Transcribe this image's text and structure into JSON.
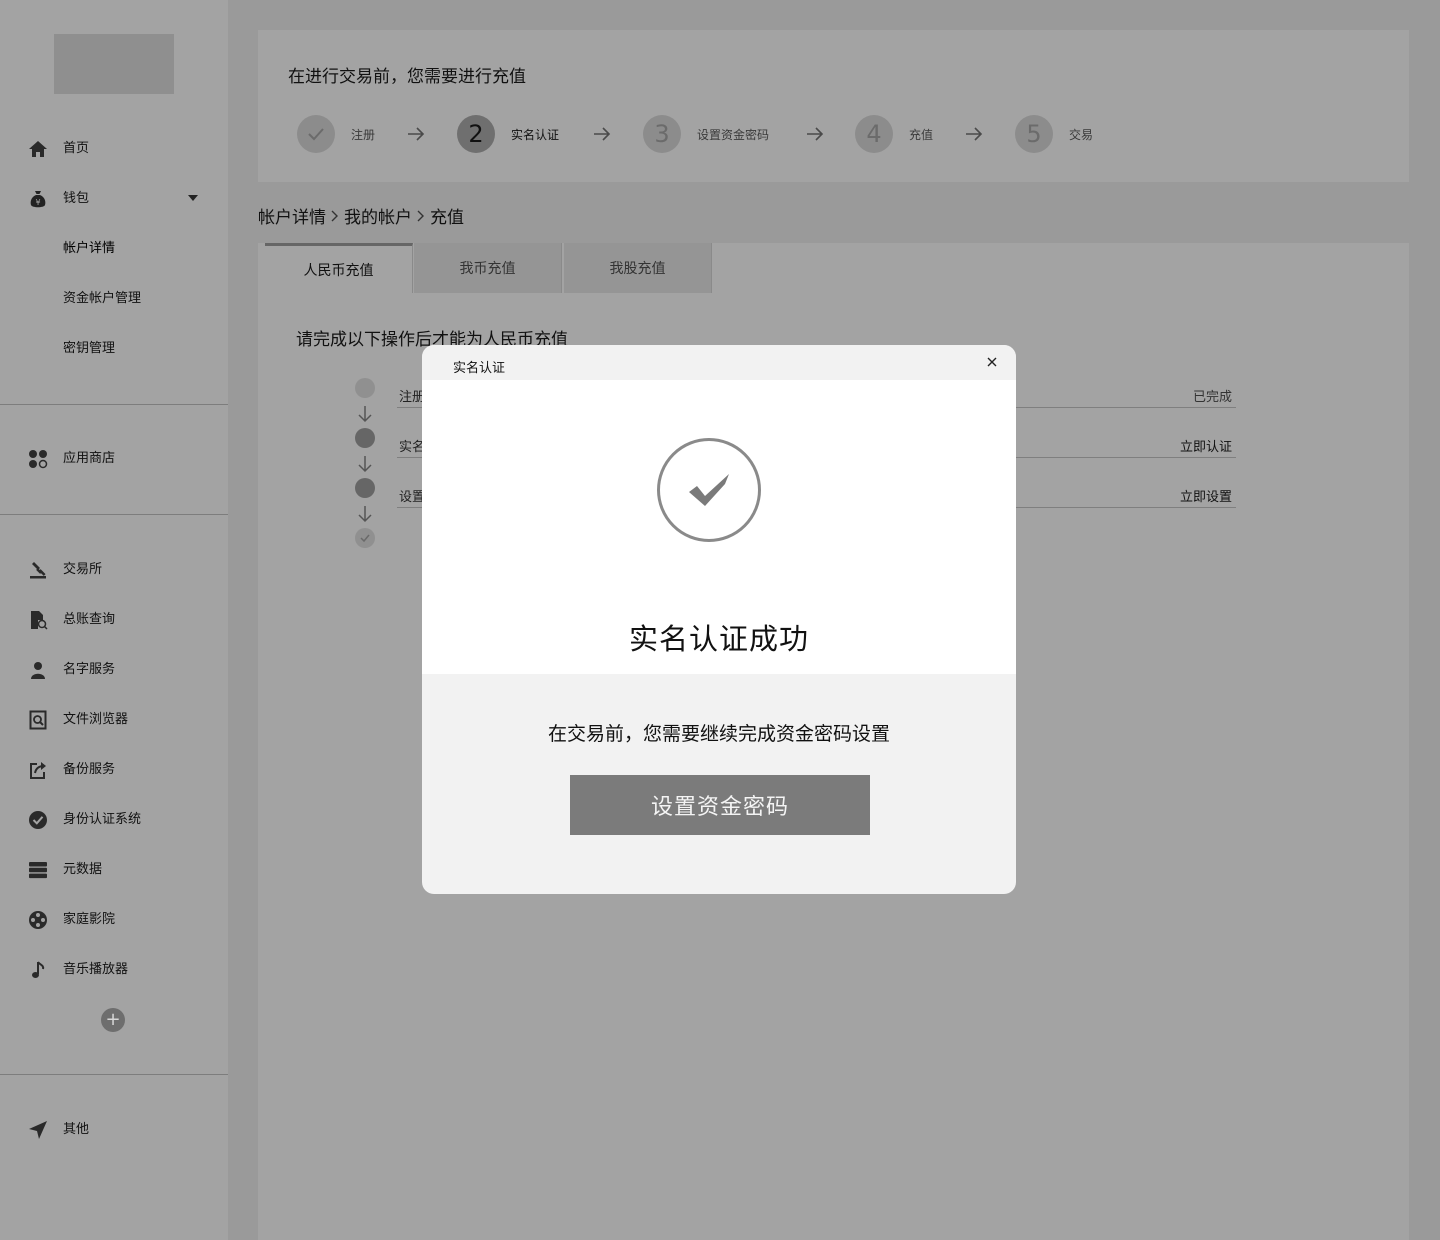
{
  "sidebar": {
    "items": [
      {
        "label": "首页",
        "icon": "home-icon"
      },
      {
        "label": "钱包",
        "icon": "money-bag-icon"
      },
      {
        "label": "帐户详情"
      },
      {
        "label": "资金帐户管理"
      },
      {
        "label": "密钥管理"
      },
      {
        "label": "应用商店",
        "icon": "apps-icon"
      },
      {
        "label": "交易所",
        "icon": "gavel-icon"
      },
      {
        "label": "总账查询",
        "icon": "ledger-search-icon"
      },
      {
        "label": "名字服务",
        "icon": "person-icon"
      },
      {
        "label": "文件浏览器",
        "icon": "file-search-icon"
      },
      {
        "label": "备份服务",
        "icon": "share-icon"
      },
      {
        "label": "身份认证系统",
        "icon": "verified-icon"
      },
      {
        "label": "元数据",
        "icon": "database-icon"
      },
      {
        "label": "家庭影院",
        "icon": "film-reel-icon"
      },
      {
        "label": "音乐播放器",
        "icon": "music-note-icon"
      },
      {
        "label": "其他",
        "icon": "navigation-arrow-icon"
      }
    ],
    "add_label": "+"
  },
  "steps": {
    "title": "在进行交易前，您需要进行充值",
    "items": [
      {
        "num": "✓",
        "label": "注册"
      },
      {
        "num": "2",
        "label": "实名认证"
      },
      {
        "num": "3",
        "label": "设置资金密码"
      },
      {
        "num": "4",
        "label": "充值"
      },
      {
        "num": "5",
        "label": "交易"
      }
    ]
  },
  "breadcrumb": [
    "帐户详情",
    "我的帐户",
    "充值"
  ],
  "tabs": [
    "人民币充值",
    "我币充值",
    "我股充值"
  ],
  "requirements": {
    "title": "请完成以下操作后才能为人民币充值",
    "rows": [
      {
        "label": "注册",
        "action": "已完成"
      },
      {
        "label": "实名",
        "action": "立即认证"
      },
      {
        "label": "设置",
        "action": "立即设置"
      }
    ]
  },
  "modal": {
    "title": "实名认证",
    "close": "×",
    "success": "实名认证成功",
    "message": "在交易前，您需要继续完成资金密码设置",
    "button": "设置资金密码"
  }
}
